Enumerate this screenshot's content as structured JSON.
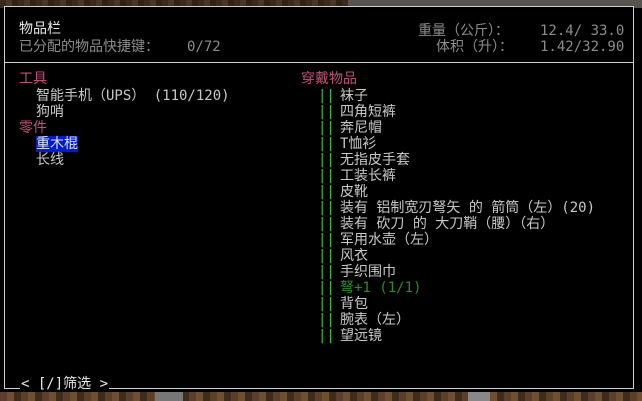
{
  "header": {
    "title": "物品栏",
    "hotkeys_label": "已分配的物品快捷键：",
    "hotkeys_value": "0/72",
    "weight_label": "重量（公斤）：",
    "weight_value": "12.4/ 33.0",
    "volume_label": "体积（升）：",
    "volume_value": "1.42/32.90"
  },
  "left": {
    "categories": [
      {
        "name": "工具",
        "items": [
          "智能手机（UPS） (110/120)",
          "狗哨"
        ]
      },
      {
        "name": "零件",
        "items": [
          "重木棍",
          "长线"
        ]
      }
    ],
    "selected_item": "重木棍"
  },
  "right": {
    "category": "穿戴物品",
    "items": [
      "袜子",
      "四角短裤",
      "奔尼帽",
      "T恤衫",
      "无指皮手套",
      "工装长裤",
      "皮靴",
      "装有 铝制宽刃弩矢 的 箭筒（左）(20)",
      "装有 砍刀 的 大刀鞘（腰）（右）",
      "军用水壶（左）",
      "风衣",
      "手织围巾",
      "弩+1 (1/1)",
      "背包",
      "腕表（左）",
      "望远镜"
    ],
    "highlight_index": 12,
    "bar_glyph": "||"
  },
  "footer": {
    "filter_label": "< [/]筛选 >"
  },
  "colors": {
    "category": "#c0507a",
    "selection": "#0018d8",
    "bars": "#2ec52e"
  }
}
